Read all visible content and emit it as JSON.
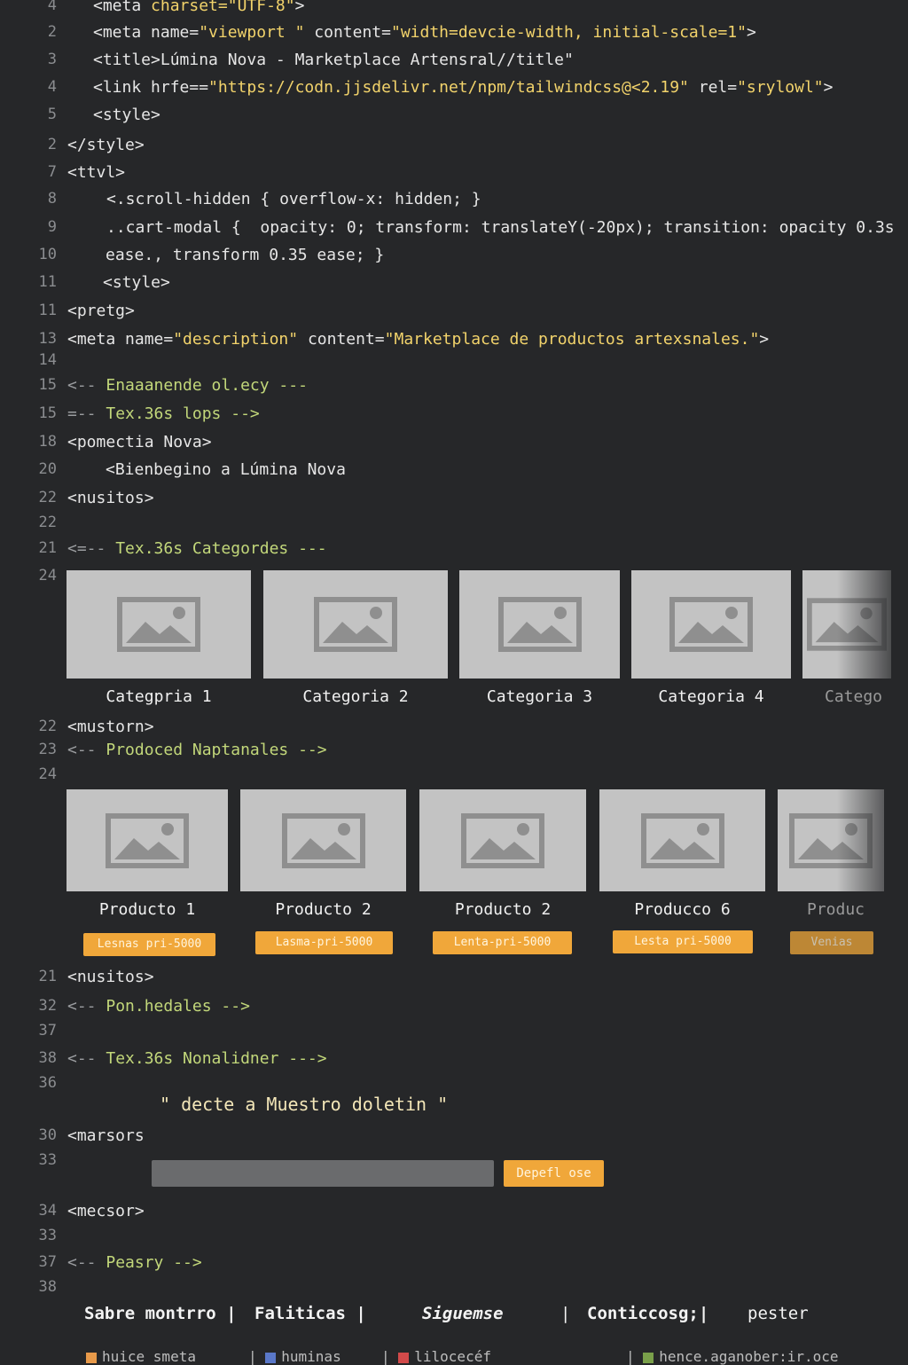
{
  "code_lines": [
    {
      "n": "4",
      "html": "<span class=\"tag\">&lt;meta </span><span class=\"str\">charset=\"UTF-8\"</span><span class=\"tag\">&gt;</span>"
    },
    {
      "n": "2",
      "text": "<meta name=\"viewport \" content=\"width=devcie-width, initial-scale=1\">"
    },
    {
      "n": "3",
      "text": "<title>Lúmina Nova - Marketplace Artensral//title\""
    },
    {
      "n": "4",
      "text": "<link hrfe==\"https://codn.jjsdelivr.net/npm/tailwindcss@<2.19\" rel=\"srylowl\">"
    },
    {
      "n": "5",
      "text": "<style>"
    },
    {
      "n": "2",
      "text": "</style>"
    },
    {
      "n": "7",
      "text": "<ttvl>"
    },
    {
      "n": "8",
      "text": "<.scroll-hidden { overflow-x: hidden; }"
    },
    {
      "n": "9",
      "text": "..cart-modal {  opacity: 0; transform: translateY(-20px); transition: opacity 0.3s"
    },
    {
      "n": "10",
      "text": "ease., transform 0.35 ease; }"
    },
    {
      "n": "11",
      "text": "<style>"
    },
    {
      "n": "11",
      "text": "<pretg>"
    },
    {
      "n": "13",
      "text": "<meta name=\"description\" content=\"Marketplace de productos artexsnales.\">"
    },
    {
      "n": "14",
      "text": ""
    },
    {
      "n": "15",
      "text": "<-- Enaaanende ol.ecy ---"
    },
    {
      "n": "15",
      "text": "=-- Tex.36s lops -->"
    },
    {
      "n": "18",
      "text": "<pomectia Nova>"
    },
    {
      "n": "20",
      "text": "<Bienbegino a Lúmina Nova"
    },
    {
      "n": "22",
      "text": "<nusitos>"
    },
    {
      "n": "22",
      "text": ""
    },
    {
      "n": "21",
      "text": "<=-- Tex.36s Categordes ---"
    },
    {
      "n": "24",
      "text": ""
    }
  ],
  "categories": [
    "Categpria 1",
    "Categoria 2",
    "Categoria 3",
    "Categoria 4",
    "Catego"
  ],
  "mid_lines": [
    {
      "n": "22",
      "text": "<mustorn>"
    },
    {
      "n": "23",
      "text": "<-- Prodoced Naptanales -->"
    },
    {
      "n": "24",
      "text": ""
    }
  ],
  "products": [
    {
      "name": "Producto 1",
      "price": "Lesnas pri-5000"
    },
    {
      "name": "Producto 2",
      "price": "Lasma-pri-5000"
    },
    {
      "name": "Producto 2",
      "price": "Lenta-pri-5000"
    },
    {
      "name": "Producco 6",
      "price": "Lesta pri-5000"
    },
    {
      "name": "Produc",
      "price": "Venias"
    }
  ],
  "lower_lines": [
    {
      "n": "21",
      "text": "<nusitos>"
    },
    {
      "n": "32",
      "text": "<-- Pon.hedales -->"
    },
    {
      "n": "37",
      "text": ""
    },
    {
      "n": "38",
      "text": "<-- Tex.36s Nonalidner --->"
    },
    {
      "n": "36",
      "text": ""
    },
    {
      "n": "30",
      "text": "<marsors"
    },
    {
      "n": "33",
      "text": ""
    },
    {
      "n": "34",
      "text": "<mecsor>"
    },
    {
      "n": "33",
      "text": ""
    },
    {
      "n": "37",
      "text": "<-- Peasry -->"
    },
    {
      "n": "38",
      "text": ""
    }
  ],
  "newsletter": {
    "title": "\" decte a Muestro doletin \"",
    "button": "Depefl ose"
  },
  "footer": {
    "links": [
      "Sabre montrro |",
      "Faliticas |",
      "Siguemse",
      "|",
      "Conticcosg;|",
      "pester"
    ]
  },
  "social": [
    "huice smeta",
    "huminas",
    "lilocecéf",
    "hence.aganober:ir.oce"
  ],
  "colors": {
    "background": "#262729",
    "accent": "#f0a73a",
    "thumb": "#c3c3c3"
  }
}
